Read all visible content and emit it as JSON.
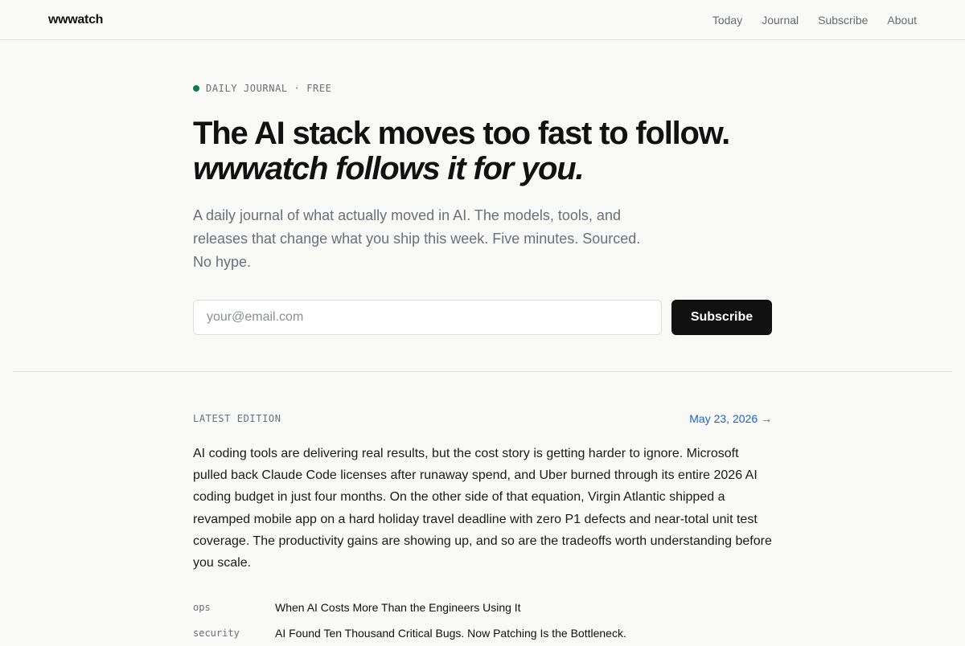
{
  "header": {
    "logo": "wwwatch",
    "nav": [
      {
        "label": "Today"
      },
      {
        "label": "Journal"
      },
      {
        "label": "Subscribe"
      },
      {
        "label": "About"
      }
    ]
  },
  "hero": {
    "eyebrow": "DAILY JOURNAL · FREE",
    "headline_line1": "The AI stack moves too fast to follow.",
    "headline_line2": "wwwatch follows it for you.",
    "lede": "A daily journal of what actually moved in AI. The models, tools, and releases that change what you ship this week. Five minutes. Sourced. No hype.",
    "email_placeholder": "your@email.com",
    "email_value": "",
    "subscribe_label": "Subscribe"
  },
  "latest": {
    "label": "LATEST EDITION",
    "date_link": "May 23, 2026 →",
    "summary": "AI coding tools are delivering real results, but the cost story is getting harder to ignore. Microsoft pulled back Claude Code licenses after runaway spend, and Uber burned through its entire 2026 AI coding budget in just four months. On the other side of that equation, Virgin Atlantic shipped a revamped mobile app on a hard holiday travel deadline with zero P1 defects and near-total unit test coverage. The productivity gains are showing up, and so are the tradeoffs worth understanding before you scale.",
    "stories": [
      {
        "tag": "ops",
        "title": "When AI Costs More Than the Engineers Using It"
      },
      {
        "tag": "security",
        "title": "AI Found Ten Thousand Critical Bugs. Now Patching Is the Bottleneck."
      }
    ]
  },
  "colors": {
    "accent_green": "#0f7a4f",
    "link_blue": "#1a64c9",
    "button_bg": "#111111",
    "page_bg": "#f9f9f8"
  }
}
